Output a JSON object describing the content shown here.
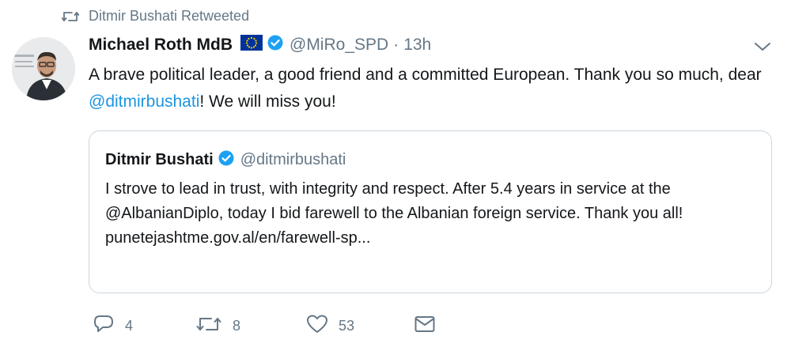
{
  "retweet_bar": {
    "text": "Ditmir Bushati Retweeted"
  },
  "tweet": {
    "author_name": "Michael Roth MdB",
    "author_handle": "@MiRo_SPD",
    "separator": "·",
    "time": "13h",
    "text_part1": "A brave political leader, a good friend and a committed European. Thank you so much, dear ",
    "mention": "@ditmirbushati",
    "text_part2": "! We will miss you!"
  },
  "quoted_tweet": {
    "author_name": "Ditmir Bushati",
    "author_handle": "@ditmirbushati",
    "text": "I strove to lead in trust, with integrity and respect. After 5.4 years in service at the @AlbanianDiplo, today I bid farewell to the Albanian foreign service. Thank you all!",
    "link": "punetejashtme.gov.al/en/farewell-sp..."
  },
  "actions": {
    "reply_count": "4",
    "retweet_count": "8",
    "like_count": "53"
  },
  "colors": {
    "link": "#1b95e0",
    "secondary_text": "#657786",
    "verified": "#1da1f2",
    "eu_blue": "#003399",
    "eu_yellow": "#ffcc00"
  },
  "icons": [
    "retweet-icon",
    "eu-flag-icon",
    "verified-badge-icon",
    "chevron-down-icon",
    "reply-icon",
    "heart-icon",
    "message-icon"
  ]
}
